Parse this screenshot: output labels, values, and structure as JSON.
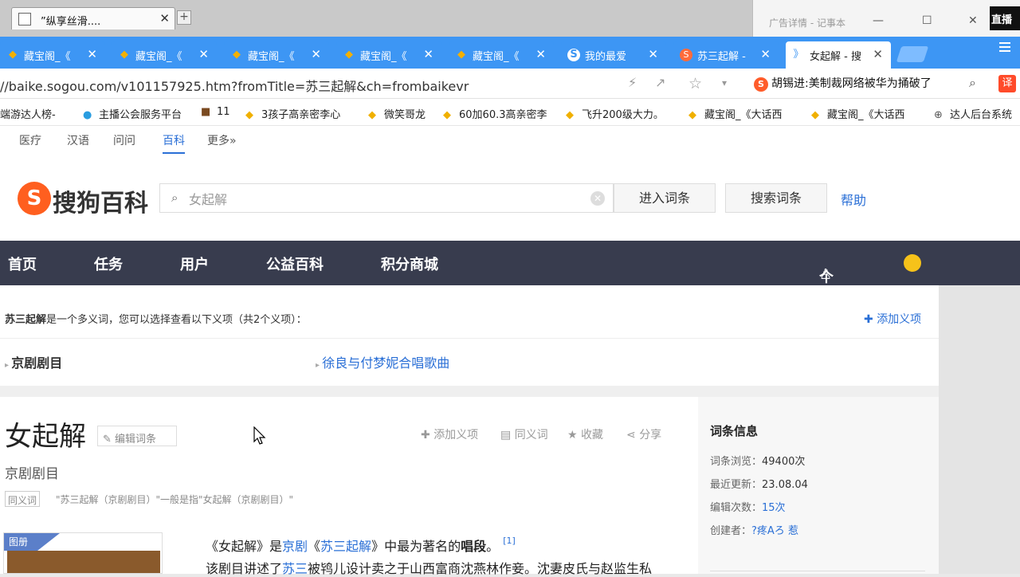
{
  "window": {
    "tab_title": "”纵享丝滑....",
    "notepad_title": "广告详情 - 记事本",
    "corner_label": "直播"
  },
  "tabs": [
    {
      "label": "藏宝阁_《",
      "icon": "treasure-icon"
    },
    {
      "label": "藏宝阁_《",
      "icon": "treasure-icon"
    },
    {
      "label": "藏宝阁_《",
      "icon": "treasure-icon"
    },
    {
      "label": "藏宝阁_《",
      "icon": "treasure-icon"
    },
    {
      "label": "藏宝阁_《",
      "icon": "treasure-icon"
    },
    {
      "label": "我的最爱",
      "icon": "sogou-icon"
    },
    {
      "label": "苏三起解 -",
      "icon": "sogou-search-icon"
    },
    {
      "label": "女起解 - 搜",
      "icon": "sogou-baike-icon"
    }
  ],
  "address": {
    "url": "//baike.sogou.com/v101157925.htm?fromTitle=苏三起解&ch=frombaikevr",
    "news": "胡锡进:美制裁网络被华为捅破了",
    "translate": "译"
  },
  "bookmarks": [
    "端游达人榜-",
    "主播公会服务平台",
    "11",
    "3孩子高亲密李心",
    "微笑哥龙",
    "60加60.3高亲密李",
    "飞升200级大力。",
    "藏宝阁_《大话西",
    "藏宝阁_《大话西",
    "达人后台系统"
  ],
  "subnav": [
    "医疗",
    "汉语",
    "问问",
    "百科",
    "更多»"
  ],
  "logo": {
    "symbol": "S",
    "text": "搜狗百科"
  },
  "search": {
    "value": "女起解",
    "enter_button": "进入词条",
    "search_button": "搜索词条",
    "help": "帮助"
  },
  "mainnav": [
    "首页",
    "任务",
    "用户",
    "公益百科",
    "积分商城"
  ],
  "user_center": "个人中心",
  "disambiguation": {
    "term": "苏三起解",
    "text": "是一个多义词，您可以选择查看以下义项（共2个义项）：",
    "add_label": "添加义项",
    "options": [
      "京剧剧目",
      "徐良与付梦妮合唱歌曲"
    ]
  },
  "article": {
    "title": "女起解",
    "edit_label": "编辑词条",
    "subtitle": "京剧剧目",
    "syn_tag": "同义词",
    "syn_text": "\"苏三起解（京剧剧目）\"一般是指\"女起解（京剧剧目）\"",
    "actions": [
      "添加义项",
      "同义词",
      "收藏",
      "分享"
    ],
    "image_tag": "图册",
    "para1": {
      "a": "《女起解》是",
      "b": "京剧",
      "c": "《",
      "d": "苏三起解",
      "e": "》中最为著名的",
      "f": "唱段",
      "g": "。",
      "ref": "[1]"
    },
    "para2": {
      "a": "该剧目讲述了",
      "b": "苏三",
      "c": "被鸨儿设计卖之于山西富商沈燕林作妾。沈妻皮氏与赵监生私"
    }
  },
  "info": {
    "heading": "词条信息",
    "views_label": "词条浏览：",
    "views": "49400次",
    "updated_label": "最近更新：",
    "updated": "23.08.04",
    "edits_label": "编辑次数：",
    "edits": "15次",
    "creator_label": "创建者：",
    "creator": "?疼Aろ 惹"
  }
}
